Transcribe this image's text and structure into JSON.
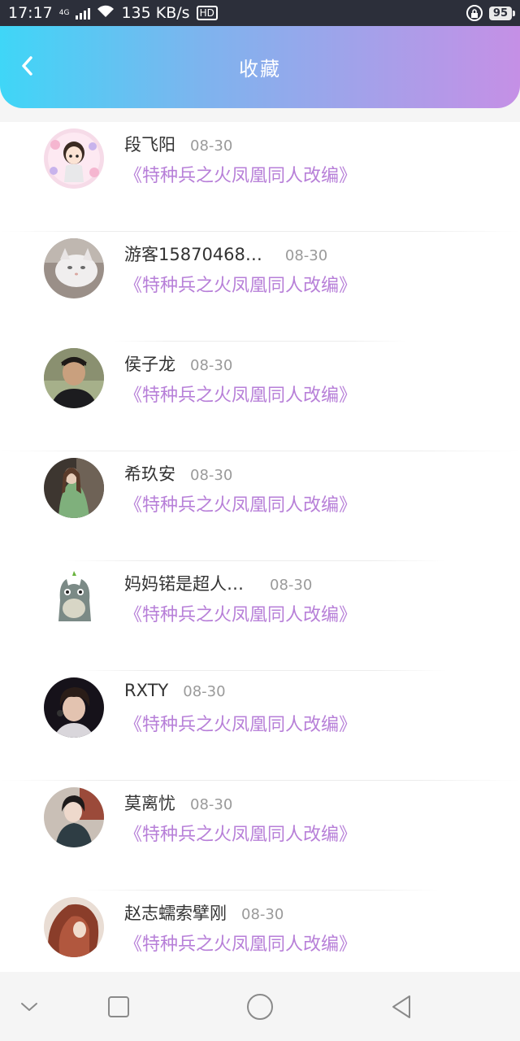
{
  "status_bar": {
    "time": "17:17",
    "network": "4G",
    "speed": "135 KB/s",
    "hd": "HD",
    "battery": "95",
    "icons": [
      "signal-icon",
      "wifi-icon",
      "lock-icon",
      "battery-icon"
    ]
  },
  "header": {
    "title": "收藏",
    "back_icon": "chevron-left-icon",
    "gradient": [
      "#3fd6f7",
      "#c590e6"
    ]
  },
  "colors": {
    "book_title": "#b77fd8",
    "name": "#333333",
    "date": "#9a9a9a"
  },
  "items": [
    {
      "name": "段飞阳",
      "date": "08-30",
      "book": "《特种兵之火凤凰同人改编》"
    },
    {
      "name": "游客15870468…",
      "date": "08-30",
      "book": "《特种兵之火凤凰同人改编》"
    },
    {
      "name": "侯子龙",
      "date": "08-30",
      "book": "《特种兵之火凤凰同人改编》"
    },
    {
      "name": "希玖安",
      "date": "08-30",
      "book": "《特种兵之火凤凰同人改编》"
    },
    {
      "name": "妈妈锘是超人…",
      "date": "08-30",
      "book": "《特种兵之火凤凰同人改编》"
    },
    {
      "name": "RXTY",
      "date": "08-30",
      "book": "《特种兵之火凤凰同人改编》"
    },
    {
      "name": "莫离忧",
      "date": "08-30",
      "book": "《特种兵之火凤凰同人改编》"
    },
    {
      "name": "赵志蠕索擘刚",
      "date": "08-30",
      "book": "《特种兵之火凤凰同人改编》"
    }
  ],
  "nav_bar": {
    "icons": [
      "collapse-chevron-icon",
      "recents-square-icon",
      "home-circle-icon",
      "back-triangle-icon"
    ]
  }
}
